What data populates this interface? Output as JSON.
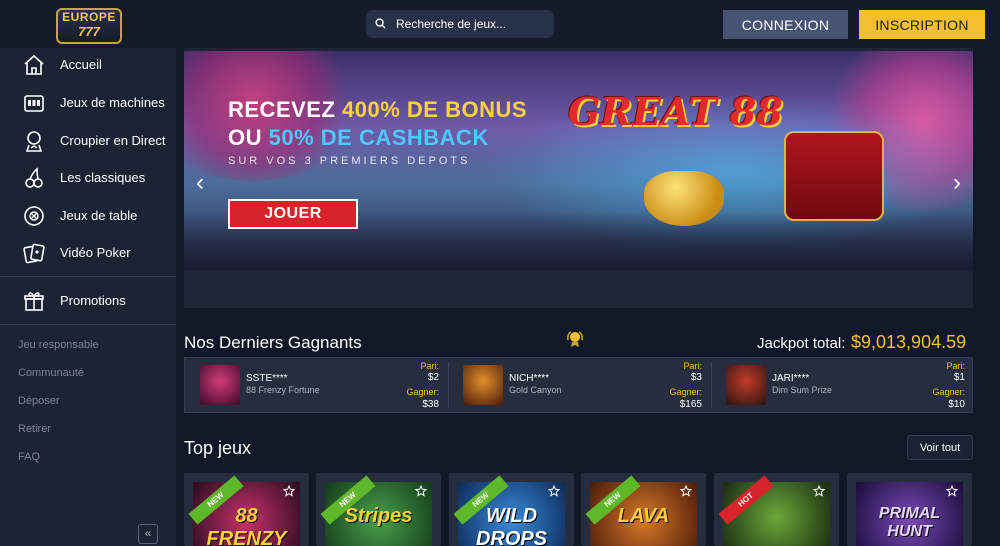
{
  "header": {
    "logo": {
      "line1": "EUROPE",
      "line2": "777"
    },
    "search_placeholder": "Recherche de jeux...",
    "login_label": "CONNEXION",
    "signup_label": "INSCRIPTION"
  },
  "sidebar": {
    "items": [
      {
        "label": "Accueil",
        "icon": "home-icon"
      },
      {
        "label": "Jeux de machines",
        "icon": "slot-machine-icon"
      },
      {
        "label": "Croupier en Direct",
        "icon": "dealer-icon"
      },
      {
        "label": "Les classiques",
        "icon": "cherries-icon"
      },
      {
        "label": "Jeux de table",
        "icon": "chip-icon"
      },
      {
        "label": "Vidéo Poker",
        "icon": "cards-icon"
      }
    ],
    "promotions": {
      "label": "Promotions",
      "icon": "gift-icon"
    },
    "links": [
      "Jeu responsable",
      "Communauté",
      "Déposer",
      "Retirer",
      "FAQ"
    ],
    "collapse_label": "«"
  },
  "banner": {
    "line1_prefix": "RECEVEZ ",
    "line1_highlight": "400% DE BONUS",
    "line2_prefix": "OU ",
    "line2_highlight": "50% DE CASHBACK",
    "line3": "SUR VOS 3 PREMIERS DEPOTS",
    "cta_label": "JOUER",
    "game_title": "GREAT 88",
    "prev_arrow": "‹",
    "next_arrow": "›"
  },
  "winners": {
    "title": "Nos Derniers Gagnants",
    "jackpot_label": "Jackpot total:",
    "jackpot_value": "$9,013,904.59",
    "bet_label": "Pari:",
    "win_label": "Gagner:",
    "entries": [
      {
        "name": "SSTE****",
        "game": "88 Frenzy Fortune",
        "bet": "$2",
        "win": "$38"
      },
      {
        "name": "NICH****",
        "game": "Gold Canyon",
        "bet": "$3",
        "win": "$165"
      },
      {
        "name": "JARI****",
        "game": "Dim Sum Prize",
        "bet": "$1",
        "win": "$10"
      }
    ]
  },
  "top_games": {
    "title": "Top jeux",
    "see_all_label": "Voir tout",
    "cards": [
      {
        "title": "88 FRENZY",
        "badge": "NEW",
        "badge_color": "#5fb82a",
        "art_color": "#6a1a3a"
      },
      {
        "title": "Stripes",
        "badge": "NEW",
        "badge_color": "#5fb82a",
        "art_color": "#2a6a3a"
      },
      {
        "title": "WILD DROPS",
        "badge": "NEW",
        "badge_color": "#5fb82a",
        "art_color": "#1b4f8a"
      },
      {
        "title": "LAVA",
        "badge": "NEW",
        "badge_color": "#5fb82a",
        "art_color": "#7a3a1a"
      },
      {
        "title": "",
        "badge": "HOT",
        "badge_color": "#d9232a",
        "art_color": "#3a5a2a"
      },
      {
        "title": "PRIMAL HUNT",
        "badge": "",
        "badge_color": "",
        "art_color": "#4a2a6a"
      }
    ]
  }
}
